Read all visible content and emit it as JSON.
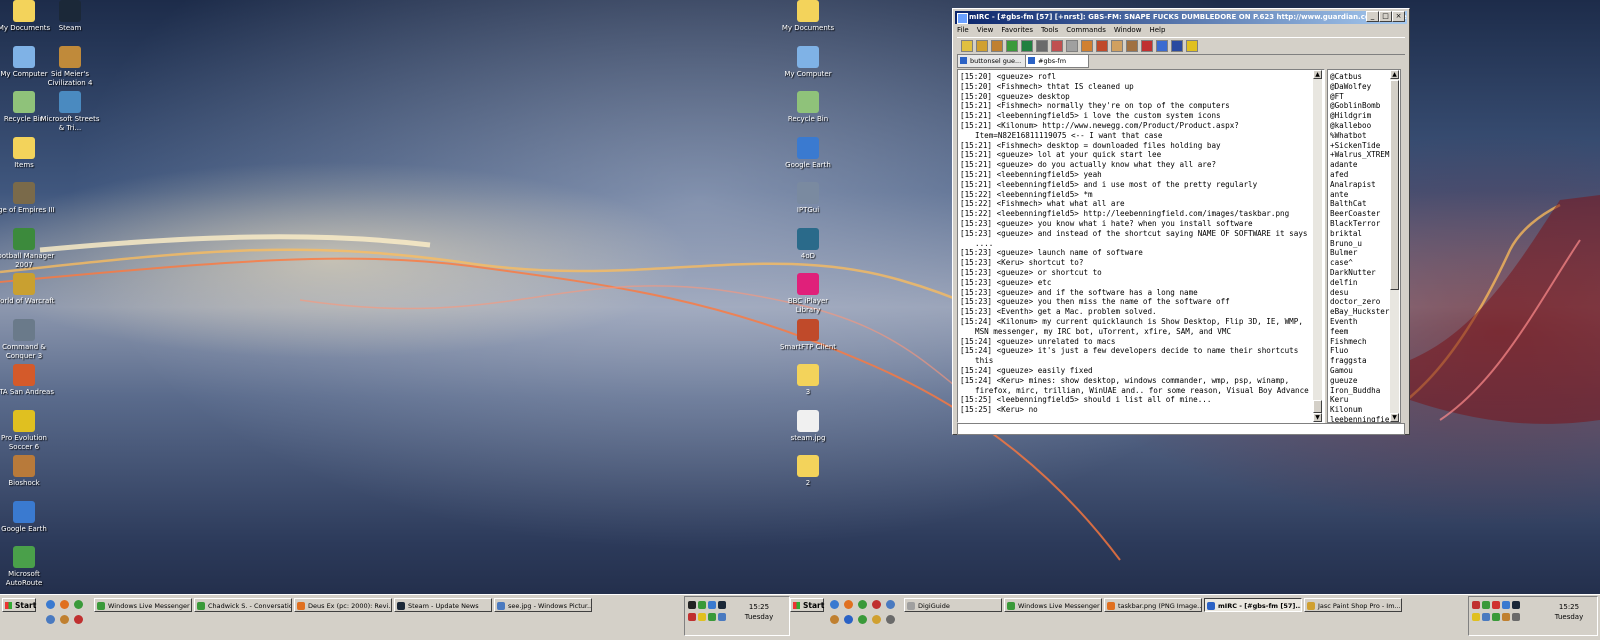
{
  "left_desktop_icons": [
    {
      "label": "My Documents",
      "icon": "folder-documents-icon",
      "color": "#f3d35b"
    },
    {
      "label": "My Computer",
      "icon": "computer-icon",
      "color": "#7fb2e6"
    },
    {
      "label": "Recycle Bin",
      "icon": "recycle-bin-icon",
      "color": "#8fc27a"
    },
    {
      "label": "Items",
      "icon": "folder-icon",
      "color": "#f3d35b"
    },
    {
      "label": "Age of Empires III",
      "icon": "age-of-empires-icon",
      "color": "#7a6a4a"
    },
    {
      "label": "Football Manager 2007",
      "icon": "football-manager-icon",
      "color": "#3c8a3c"
    },
    {
      "label": "World of Warcraft",
      "icon": "warcraft-icon",
      "color": "#c9a030"
    },
    {
      "label": "Command & Conquer 3",
      "icon": "command-conquer-icon",
      "color": "#6a7a8a"
    },
    {
      "label": "GTA San Andreas",
      "icon": "gta-icon",
      "color": "#d45a2a"
    },
    {
      "label": "Pro Evolution Soccer 6",
      "icon": "pes-icon",
      "color": "#e0c020"
    },
    {
      "label": "Bioshock",
      "icon": "bioshock-icon",
      "color": "#b87a3a"
    },
    {
      "label": "Google Earth",
      "icon": "google-earth-icon",
      "color": "#3a7ad0"
    },
    {
      "label": "Microsoft AutoRoute",
      "icon": "autoroute-icon",
      "color": "#4aa04a"
    }
  ],
  "left_desktop_icons_col2": [
    {
      "label": "Steam",
      "icon": "steam-icon",
      "color": "#1b2838"
    },
    {
      "label": "Sid Meier's Civilization 4",
      "icon": "civilization-icon",
      "color": "#c08a3a"
    },
    {
      "label": "Microsoft Streets & Tri...",
      "icon": "streets-trips-icon",
      "color": "#4a8ac0"
    }
  ],
  "right_desktop_icons": [
    {
      "label": "My Documents",
      "icon": "folder-documents-icon",
      "color": "#f3d35b"
    },
    {
      "label": "My Computer",
      "icon": "computer-icon",
      "color": "#7fb2e6"
    },
    {
      "label": "Recycle Bin",
      "icon": "recycle-bin-icon",
      "color": "#8fc27a"
    },
    {
      "label": "Google Earth",
      "icon": "google-earth-icon",
      "color": "#3a7ad0"
    },
    {
      "label": "IPTGui",
      "icon": "iptgui-icon",
      "color": "#7a8aa0"
    },
    {
      "label": "4oD",
      "icon": "4od-icon",
      "color": "#2a6a8a"
    },
    {
      "label": "BBC iPlayer Library",
      "icon": "bbc-iplayer-icon",
      "color": "#e0207a"
    },
    {
      "label": "SmartFTP Client",
      "icon": "smartftp-icon",
      "color": "#c04a2a"
    },
    {
      "label": "3",
      "icon": "folder-icon",
      "color": "#f3d35b"
    },
    {
      "label": "steam.jpg",
      "icon": "image-file-icon",
      "color": "#f0f0f0"
    },
    {
      "label": "2",
      "icon": "folder-icon",
      "color": "#f3d35b"
    }
  ],
  "mirc": {
    "title": "mIRC - [#gbs-fm [57] [+nrst]: GBS-FM: SNAPE FUCKS DUMBLEDORE ON P.623 http://www.guardian.co.uk/film/ever/u...",
    "menu": [
      "File",
      "View",
      "Favorites",
      "Tools",
      "Commands",
      "Window",
      "Help"
    ],
    "tabs": [
      "buttonsel gue...",
      "#gbs-fm"
    ],
    "chat_lines": [
      "[15:20] <gueuze> rofl",
      "[15:20] <Fishmech> thtat IS cleaned up",
      "[15:20] <gueuze> desktop",
      "[15:21] <Fishmech> normally they're on top of the computers",
      "[15:21] <leebenningfield5> i love the custom system icons",
      "[15:21] <Kilonum> http://www.newegg.com/Product/Product.aspx?Item=N82E16811119075 <-- I want that case",
      "[15:21] <Fishmech> desktop = downloaded files holding bay",
      "[15:21] <gueuze> lol at your quick start lee",
      "[15:21] <gueuze> do you actually know what they all are?",
      "[15:21] <leebenningfield5> yeah",
      "[15:21] <leebenningfield5> and i use most of the pretty regularly",
      "[15:22] <leebenningfield5> *m",
      "[15:22] <Fishmech> what what all are",
      "[15:22] <leebenningfield5> http://leebenningfield.com/images/taskbar.png",
      "[15:23] <gueuze> you know what i hate? when you install software",
      "[15:23] <gueuze> and instead of the shortcut saying NAME OF SOFTWARE it says ....",
      "[15:23] <gueuze> launch name of software",
      "[15:23] <Keru> shortcut to?",
      "[15:23] <gueuze> or shortcut to",
      "[15:23] <gueuze> etc",
      "[15:23] <gueuze> and if the software has a long name",
      "[15:23] <gueuze> you then miss the name of the software off",
      "[15:23] <Eventh> get a Mac. problem solved.",
      "[15:24] <Kilonum> my current quicklaunch is Show Desktop, Flip 3D, IE, WMP, MSN messenger, my IRC bot, uTorrent, xfire, SAM, and VMC",
      "[15:24] <gueuze> unrelated to macs",
      "[15:24] <gueuze> it's just a few developers decide to name their shortcuts this",
      "[15:24] <gueuze> easily fixed",
      "[15:24] <Keru> mines: show desktop, windows commander, wmp, psp, winamp, firefox, mirc, trillian, WinUAE and.. for some reason, Visual Boy Advance",
      "[15:25] <leebenningfield5> should i list all of mine...",
      "[15:25] <Keru> no"
    ],
    "nicks": [
      "@Catbus",
      "@DaWolfey",
      "@FT",
      "@GoblinBomb",
      "@Hildgrim",
      "@kalleboo",
      "%Whatbot",
      "+SickenTide",
      "+Walrus_XTREME",
      "adante",
      "afed",
      "Analrapist",
      "ante",
      "BalthCat",
      "BeerCoaster",
      "BlackTerror",
      "briktal",
      "Bruno_u",
      "Bulmer",
      "case^",
      "DarkNutter",
      "delfin",
      "desu",
      "doctor_zero",
      "eBay_Huckster",
      "Eventh",
      "feem",
      "Fishmech",
      "Fluo",
      "fraggsta",
      "Gamou",
      "gueuze",
      "Iron_Buddha",
      "Keru",
      "Kilonum",
      "leebenningfiel"
    ]
  },
  "taskbar_left": {
    "start_label": "Start",
    "tasks": [
      {
        "label": "Windows Live Messenger",
        "icon": "messenger-icon",
        "color": "#3a9a3a"
      },
      {
        "label": "Chadwick S. - Conversation",
        "icon": "conversation-icon",
        "color": "#3a9a3a"
      },
      {
        "label": "Deus Ex (pc: 2000): Revi...",
        "icon": "firefox-icon",
        "color": "#e07020"
      },
      {
        "label": "Steam - Update News",
        "icon": "steam-icon",
        "color": "#1b2838"
      },
      {
        "label": "see.jpg - Windows Pictur...",
        "icon": "picture-viewer-icon",
        "color": "#4a7ac0"
      }
    ],
    "clock_time": "15:25",
    "clock_day": "Tuesday"
  },
  "taskbar_right": {
    "start_label": "Start",
    "tasks": [
      {
        "label": "DigiGuide",
        "icon": "digiguide-icon",
        "color": "#a0a0a0"
      },
      {
        "label": "Windows Live Messenger",
        "icon": "messenger-icon",
        "color": "#3a9a3a"
      },
      {
        "label": "taskbar.png (PNG Image...",
        "icon": "firefox-icon",
        "color": "#e07020"
      },
      {
        "label": "mIRC - [#gbs-fm [57]...",
        "icon": "mirc-icon",
        "color": "#2b62c5",
        "active": true
      },
      {
        "label": "Jasc Paint Shop Pro - Im...",
        "icon": "paint-shop-icon",
        "color": "#d0a030"
      }
    ],
    "clock_time": "15:25",
    "clock_day": "Tuesday"
  }
}
